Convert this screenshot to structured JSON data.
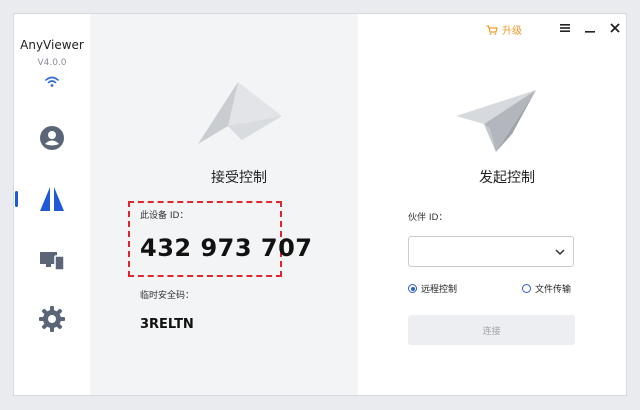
{
  "app": {
    "name": "AnyViewer",
    "version": "V4.0.0"
  },
  "titlebar": {
    "upgrade_label": "升级"
  },
  "receive": {
    "heading": "接受控制",
    "device_id_label": "此设备 ID：",
    "device_id": "432 973 707",
    "temp_code_label": "临时安全码：",
    "temp_code": "3RELTN"
  },
  "initiate": {
    "heading": "发起控制",
    "partner_label": "伙伴 ID：",
    "partner_value": "",
    "options": [
      "远程控制",
      "文件传输"
    ],
    "selected_option": "远程控制",
    "connect_label": "连接"
  },
  "colors": {
    "accent": "#1f5bd6",
    "upgrade": "#f19a2b",
    "highlight": "#e0262b"
  },
  "icons": {
    "nav": [
      "user-icon",
      "remote-control-icon",
      "devices-icon",
      "settings-icon"
    ]
  }
}
